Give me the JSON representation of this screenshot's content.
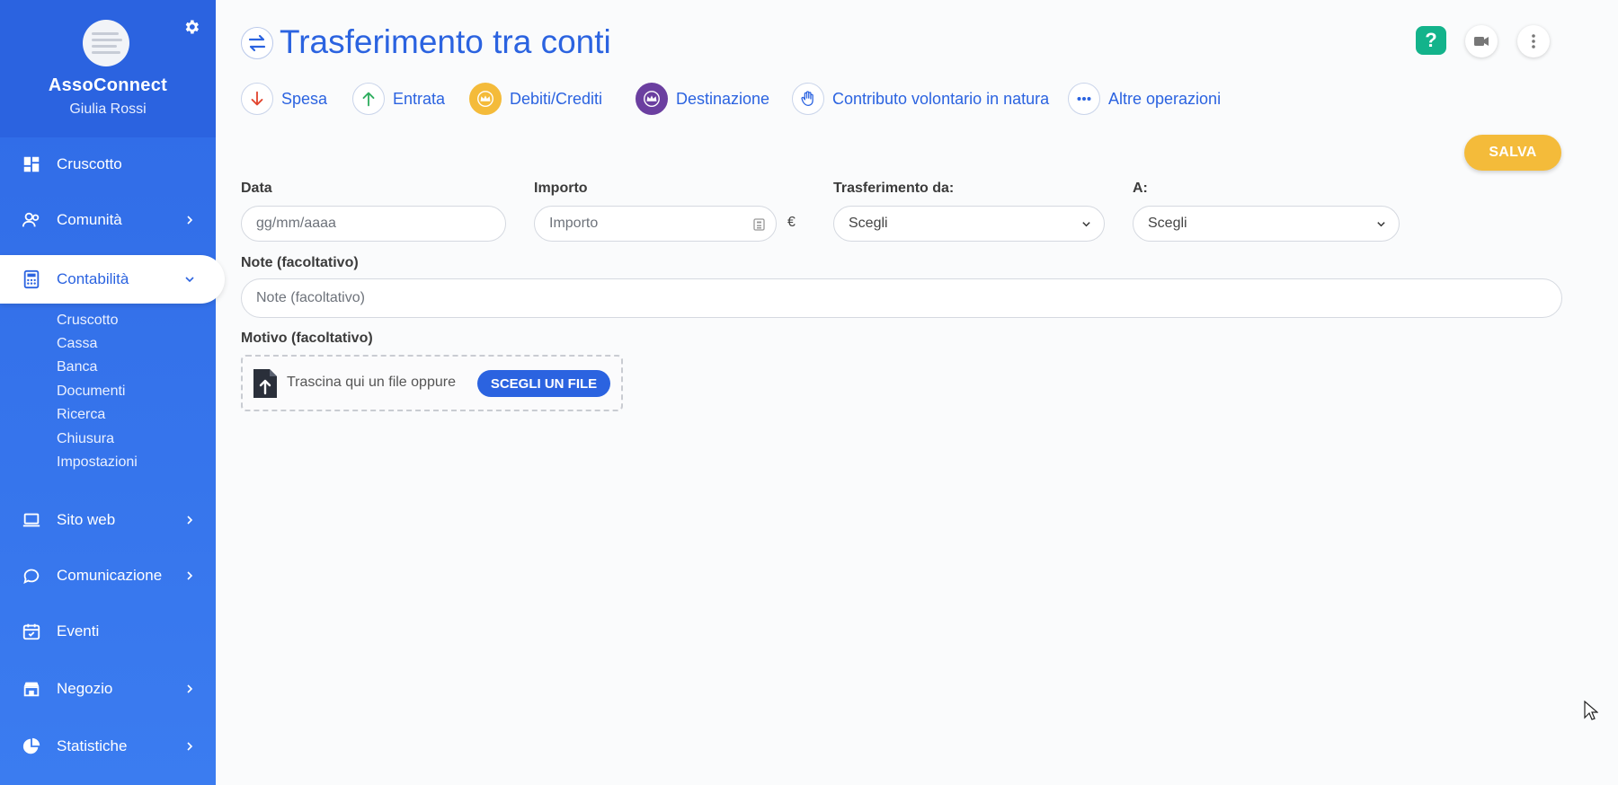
{
  "sidebar": {
    "brand": "AssoConnect",
    "user_name": "Giulia Rossi",
    "items": [
      {
        "label": "Cruscotto",
        "icon": "dashboard-icon"
      },
      {
        "label": "Comunità",
        "icon": "users-icon"
      },
      {
        "label": "Contabilità",
        "icon": "calculator-icon"
      },
      {
        "label": "Sito web",
        "icon": "laptop-icon"
      },
      {
        "label": "Comunicazione",
        "icon": "chat-icon"
      },
      {
        "label": "Eventi",
        "icon": "calendar-icon"
      },
      {
        "label": "Negozio",
        "icon": "shop-icon"
      },
      {
        "label": "Statistiche",
        "icon": "pie-chart-icon"
      }
    ],
    "subitems": [
      "Cruscotto",
      "Cassa",
      "Banca",
      "Documenti",
      "Ricerca",
      "Chiusura",
      "Impostazioni"
    ]
  },
  "page": {
    "title": "Trasferimento tra conti",
    "help_label": "?"
  },
  "operations": [
    {
      "label": "Spesa",
      "icon": "arrow-down-icon",
      "color": "#e2462f"
    },
    {
      "label": "Entrata",
      "icon": "arrow-up-icon",
      "color": "#2fae5f"
    },
    {
      "label": "Debiti/Crediti",
      "icon": "crown-icon",
      "color": "#f4bb3a"
    },
    {
      "label": "Destinazione",
      "icon": "crown-purple-icon",
      "color": "#6b3fa0"
    },
    {
      "label": "Contributo volontario in natura",
      "icon": "hand-icon",
      "color": "#2b63e0"
    },
    {
      "label": "Altre operazioni",
      "icon": "more-dots-icon",
      "color": "#2b63e0"
    }
  ],
  "actions": {
    "save_label": "SALVA"
  },
  "form": {
    "date_label": "Data",
    "date_placeholder": "gg/mm/aaaa",
    "amount_label": "Importo",
    "amount_placeholder": "Importo",
    "currency": "€",
    "from_label": "Trasferimento da:",
    "from_value": "Scegli",
    "to_label": "A:",
    "to_value": "Scegli",
    "notes_label": "Note (facoltativo)",
    "notes_placeholder": "Note (facoltativo)",
    "reason_label": "Motivo (facoltativo)",
    "dropzone_text": "Trascina qui un file oppure",
    "choose_file_label": "SCEGLI UN FILE"
  },
  "colors": {
    "primary": "#2b63e0",
    "accent_save": "#f4bb3a",
    "help_green": "#13b38b"
  }
}
